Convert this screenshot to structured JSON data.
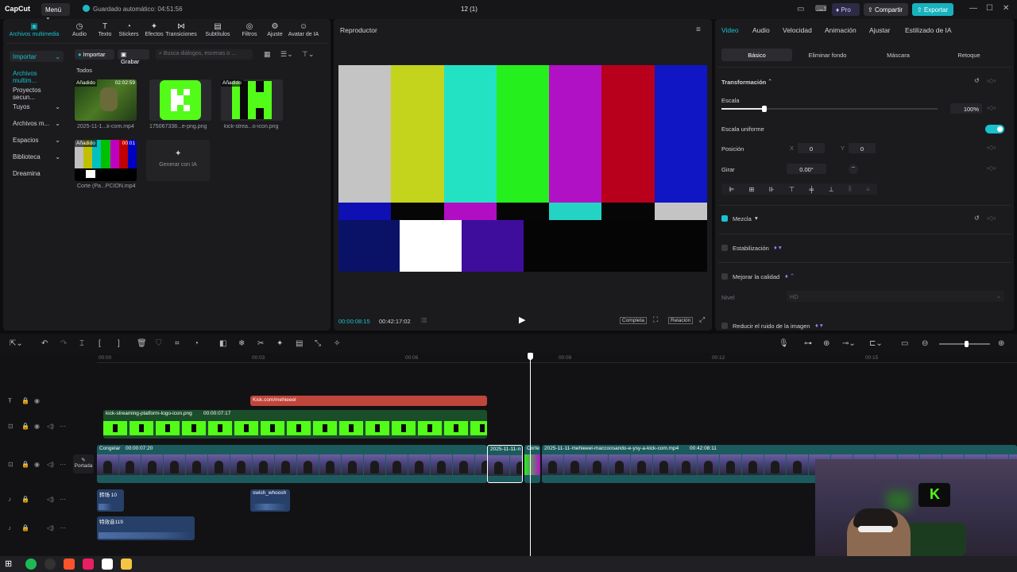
{
  "topbar": {
    "logo": "CapCut",
    "menu": "Menú",
    "autosave": "Guardado automático: 04:51:56",
    "project_title": "12 (1)",
    "pro": "Pro",
    "share": "Compartir",
    "export": "Exportar"
  },
  "tools": [
    {
      "label": "Archivos multimedia",
      "icon": "media-icon"
    },
    {
      "label": "Audio",
      "icon": "audio-icon"
    },
    {
      "label": "Texto",
      "icon": "text-icon"
    },
    {
      "label": "Stickers",
      "icon": "sticker-icon"
    },
    {
      "label": "Efectos",
      "icon": "effects-icon"
    },
    {
      "label": "Transiciones",
      "icon": "transitions-icon"
    },
    {
      "label": "Subtítulos",
      "icon": "subtitles-icon"
    },
    {
      "label": "Filtros",
      "icon": "filters-icon"
    },
    {
      "label": "Ajuste",
      "icon": "adjust-icon"
    },
    {
      "label": "Avatar de IA",
      "icon": "avatar-icon"
    }
  ],
  "media": {
    "side": [
      "Importar",
      "Archivos multim...",
      "Proyectos secun...",
      "Tuyos",
      "Archivos m...",
      "Espacios",
      "Biblioteca",
      "Dreamina"
    ],
    "import_btn": "Importar",
    "record_btn": "Grabar",
    "search_placeholder": "Busca diálogos, escenas o ...",
    "section": "Todos",
    "items": [
      {
        "name": "2025-11-1...k-com.mp4",
        "badge": "Añadido",
        "duration": "02:02:59"
      },
      {
        "name": "175067338...e-png.png",
        "badge": "",
        "duration": ""
      },
      {
        "name": "kick-strea...o-icon.png",
        "badge": "Añadido",
        "duration": ""
      },
      {
        "name": "Corte (Pa...PCION.mp4",
        "badge": "Añadido",
        "duration": "00:01"
      }
    ],
    "generate_ai": "Generar con IA"
  },
  "player": {
    "title": "Reproductor",
    "current_time": "00:00:08:15",
    "total_time": "00:42:17:02",
    "full": "Completa",
    "ratio": "Relación"
  },
  "inspector": {
    "tabs": [
      "Video",
      "Audio",
      "Velocidad",
      "Animación",
      "Ajustar",
      "Estilizado de IA"
    ],
    "subtabs": [
      "Básico",
      "Eliminar fondo",
      "Máscara",
      "Retoque"
    ],
    "transform": "Transformación",
    "scale_label": "Escala",
    "scale_value": "100%",
    "scale_level": 1.0,
    "uniform_label": "Escala uniforme",
    "position_label": "Posición",
    "pos_x_label": "X",
    "pos_x": "0",
    "pos_y_label": "Y",
    "pos_y": "0",
    "rotate_label": "Girar",
    "rotate_value": "0.00°",
    "blend": "Mezcla",
    "stabilization": "Estabilización",
    "enhance": "Mejorar la calidad",
    "level_label": "Nivel",
    "level_value": "HD",
    "noise": "Reducir el ruido de la imagen"
  },
  "timeline": {
    "ruler": [
      "00:00",
      "00:03",
      "00:06",
      "00:09",
      "00:12",
      "00:15"
    ],
    "cover": "Portada",
    "text_clip": "Kick.com/mehieeel",
    "sticker_clip": "kick-streaming-platform-logo-icon.png",
    "sticker_dur": "00:00:07:17",
    "main_clip_a": "Congelar",
    "main_clip_a_dur": "00:00:07:20",
    "main_clip_b": "2025-11-11-n",
    "main_clip_c": "Corte",
    "main_clip_d": "2025-11-11-mehieeel-maccoosando-e-ysy-a-kick-com.mp4",
    "main_clip_d_dur": "00:42:08:11",
    "audio1": "转场 10",
    "audio2": "swish_whoosh",
    "audio3": "特效音119"
  },
  "colors": {
    "accent": "#19c2cf",
    "kick_green": "#53fc18",
    "text_clip": "#c0453b"
  }
}
